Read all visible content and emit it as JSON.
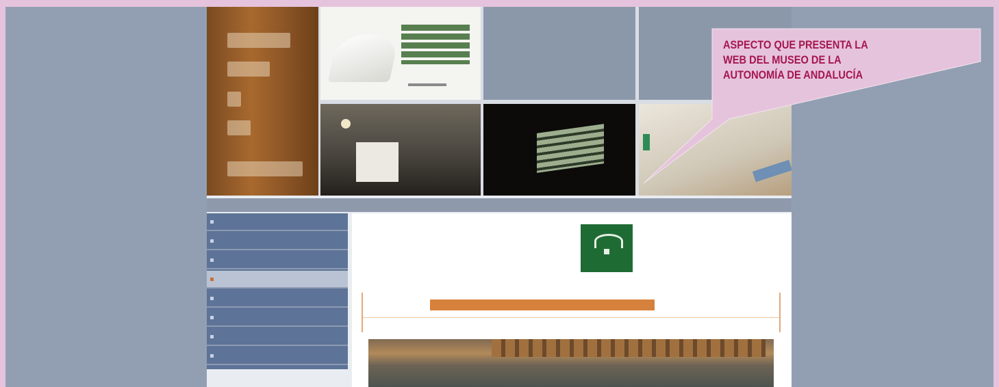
{
  "callout": {
    "line1": "ASPECTO QUE PRESENTA LA",
    "line2": "WEB DEL MUSEO DE LA",
    "line3": "AUTONOMÍA DE ANDALUCÍA"
  },
  "colors": {
    "page_border": "#e6c3dc",
    "frame": "#929fb3",
    "callout_fill": "#e6c3dc",
    "callout_text": "#a4164f",
    "menu": "#5d7397",
    "accent": "#d6813c",
    "logo_green": "#1f6b34"
  }
}
